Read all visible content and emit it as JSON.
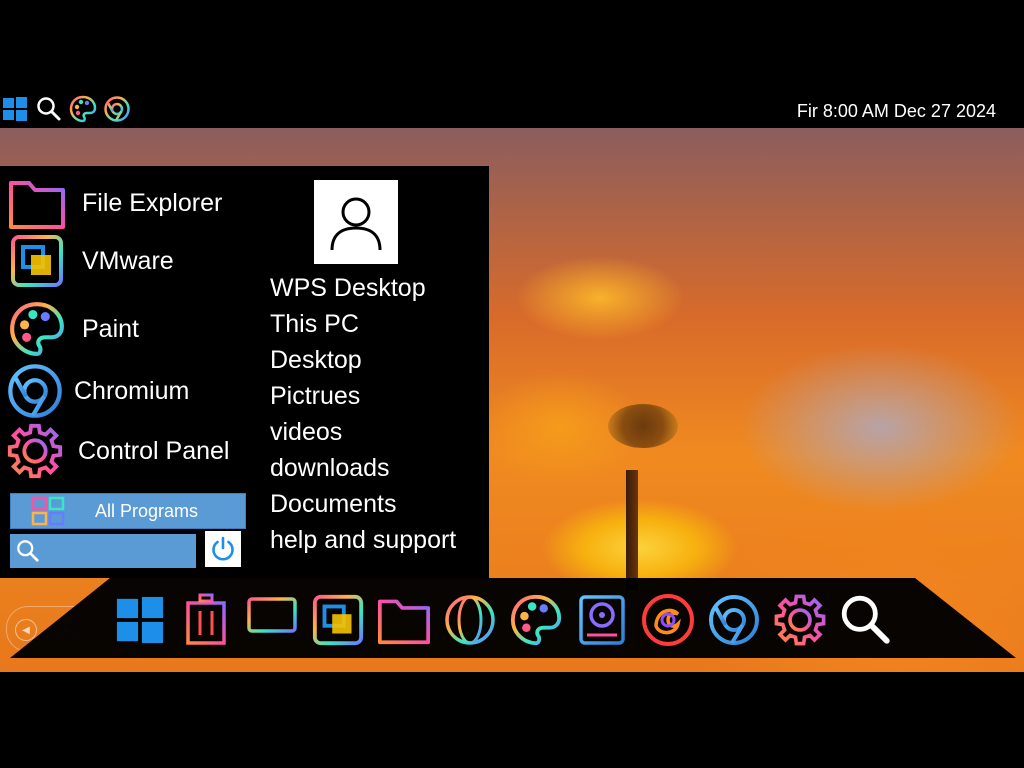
{
  "topbar": {
    "icons": [
      "windows-icon",
      "search-icon",
      "paint-icon",
      "chromium-icon"
    ],
    "clock": "Fir 8:00 AM Dec 27 2024"
  },
  "start_menu": {
    "apps": [
      {
        "label": "File Explorer",
        "icon": "folder-icon"
      },
      {
        "label": "VMware",
        "icon": "vmware-icon"
      },
      {
        "label": "Paint",
        "icon": "paint-icon"
      },
      {
        "label": "Chromium",
        "icon": "chromium-icon"
      },
      {
        "label": "Control Panel",
        "icon": "gear-icon"
      }
    ],
    "all_programs_label": "All Programs",
    "search": {
      "value": "",
      "placeholder": ""
    },
    "places": [
      "WPS Desktop",
      "This PC",
      "Desktop",
      "Pictrues",
      "videos",
      "downloads",
      "Documents",
      "help and support"
    ]
  },
  "dock": {
    "icons": [
      "windows-icon",
      "trash-icon",
      "monitor-icon",
      "vmware-icon",
      "folder-icon",
      "globe-icon",
      "paint-icon",
      "disk-utility-icon",
      "firefox-icon",
      "chromium-icon",
      "gear-icon",
      "search-icon"
    ]
  },
  "colors": {
    "menu_bg": "#000000",
    "button_blue": "#5b9bd5",
    "text": "#ffffff"
  }
}
